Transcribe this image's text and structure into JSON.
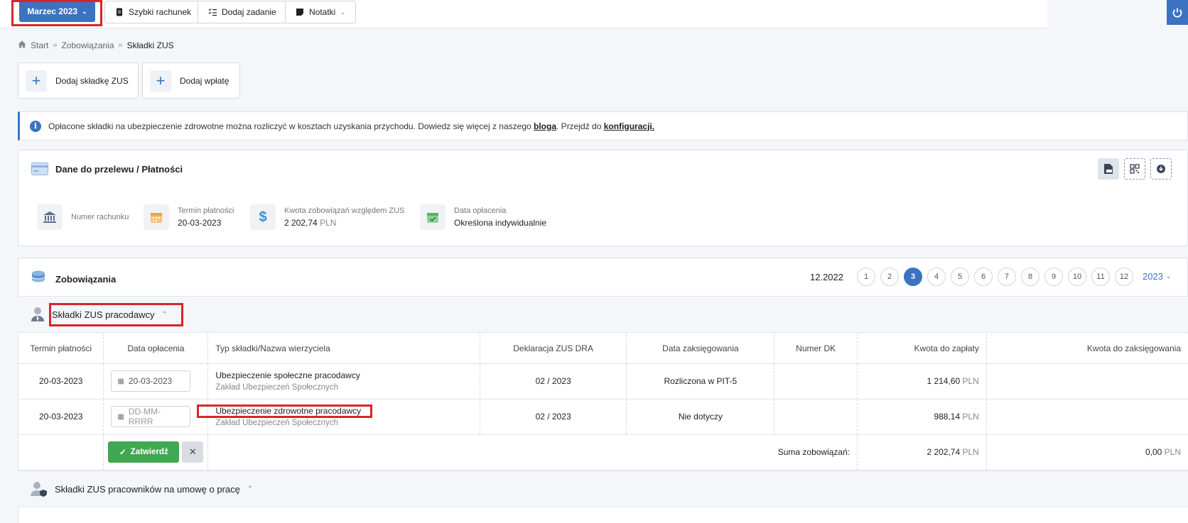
{
  "topbar": {
    "month_button": "Marzec 2023",
    "quick_invoice": "Szybki rachunek",
    "add_task": "Dodaj zadanie",
    "notes": "Notatki"
  },
  "breadcrumb": [
    "Start",
    "Zobowiązania",
    "Składki ZUS"
  ],
  "actions": {
    "add_contribution": "Dodaj składkę ZUS",
    "add_payment": "Dodaj wpłatę"
  },
  "info": {
    "text": "Opłacone składki na ubezpieczenie zdrowotne można rozliczyć w kosztach uzyskania przychodu. Dowiedz się więcej z naszego",
    "link1": "bloga",
    "mid": ". Przejdź do",
    "link2": "konfiguracji."
  },
  "payment_card": {
    "title": "Dane do przelewu / Płatności",
    "account_label": "Numer rachunku",
    "due_label": "Termin płatności",
    "due_value": "20-03-2023",
    "amount_label": "Kwota zobowiązań względem ZUS",
    "amount_value": "2 202,74",
    "currency": "PLN",
    "paid_label": "Data opłacenia",
    "paid_value": "Określona indywidualnie"
  },
  "liabilities": {
    "title": "Zobowiązania",
    "prev_period": "12.2022",
    "months": [
      "1",
      "2",
      "3",
      "4",
      "5",
      "6",
      "7",
      "8",
      "9",
      "10",
      "11",
      "12"
    ],
    "active_month": "3",
    "year": "2023"
  },
  "employer_section": {
    "title": "Składki ZUS pracodawcy",
    "columns": [
      "Termin płatności",
      "Data opłacenia",
      "Typ składki/Nazwa wierzyciela",
      "Deklaracja ZUS DRA",
      "Data zaksięgowania",
      "Numer DK",
      "Kwota do zapłaty",
      "Kwota do zaksięgowania"
    ],
    "rows": [
      {
        "due": "20-03-2023",
        "paid": "20-03-2023",
        "type": "Ubezpieczenie społeczne pracodawcy",
        "creditor": "Zakład Ubezpieczeń Społecznych",
        "dra": "02 / 2023",
        "booking": "Rozliczona w PIT-5",
        "dk": "",
        "amount": "1 214,60",
        "to_book": ""
      },
      {
        "due": "20-03-2023",
        "paid_placeholder": "DD-MM-RRRR",
        "type": "Ubezpieczenie zdrowotne pracodawcy",
        "creditor": "Zakład Ubezpieczeń Społecznych",
        "dra": "02 / 2023",
        "booking": "Nie dotyczy",
        "dk": "",
        "amount": "988,14",
        "to_book": ""
      }
    ],
    "confirm_button": "Zatwierdź",
    "sum_label": "Suma zobowiązań:",
    "sum_amount": "2 202,74",
    "sum_to_book": "0,00",
    "currency": "PLN"
  },
  "employees_section": {
    "title": "Składki ZUS pracowników na umowę o pracę"
  },
  "colors": {
    "primary": "#3b73c0",
    "success": "#3fa851",
    "highlight": "#d9242c"
  }
}
